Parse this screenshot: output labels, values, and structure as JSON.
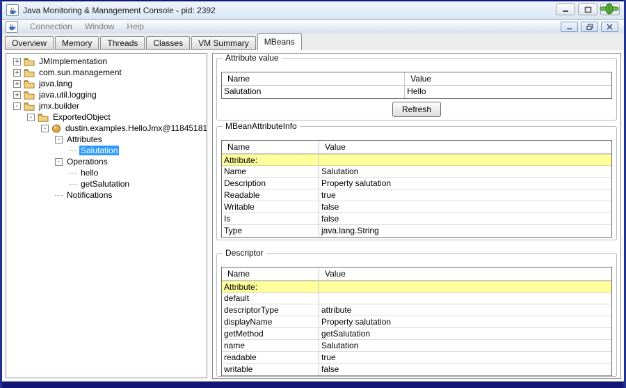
{
  "window": {
    "title": "Java Monitoring & Management Console - pid: 2392"
  },
  "menu": {
    "items": [
      "Connection",
      "Window",
      "Help"
    ]
  },
  "tabs": {
    "items": [
      "Overview",
      "Memory",
      "Threads",
      "Classes",
      "VM Summary",
      "MBeans"
    ],
    "selected": "MBeans"
  },
  "tree": {
    "nodes": [
      {
        "label": "JMImplementation",
        "level": 0,
        "toggle": "+",
        "icon": "folder",
        "selected": false
      },
      {
        "label": "com.sun.management",
        "level": 0,
        "toggle": "+",
        "icon": "folder",
        "selected": false
      },
      {
        "label": "java.lang",
        "level": 0,
        "toggle": "+",
        "icon": "folder",
        "selected": false
      },
      {
        "label": "java.util.logging",
        "level": 0,
        "toggle": "+",
        "icon": "folder",
        "selected": false
      },
      {
        "label": "jmx.builder",
        "level": 0,
        "toggle": "-",
        "icon": "folder",
        "selected": false
      },
      {
        "label": "ExportedObject",
        "level": 1,
        "toggle": "-",
        "icon": "folder",
        "selected": false
      },
      {
        "label": "dustin.examples.HelloJmx@11845181",
        "level": 2,
        "toggle": "-",
        "icon": "mbean",
        "selected": false
      },
      {
        "label": "Attributes",
        "level": 3,
        "toggle": "-",
        "icon": null,
        "selected": false
      },
      {
        "label": "Salutation",
        "level": 4,
        "toggle": null,
        "icon": null,
        "selected": true
      },
      {
        "label": "Operations",
        "level": 3,
        "toggle": "-",
        "icon": null,
        "selected": false
      },
      {
        "label": "hello",
        "level": 4,
        "toggle": null,
        "icon": null,
        "selected": false
      },
      {
        "label": "getSalutation",
        "level": 4,
        "toggle": null,
        "icon": null,
        "selected": false
      },
      {
        "label": "Notifications",
        "level": 3,
        "toggle": null,
        "icon": null,
        "selected": false
      }
    ]
  },
  "panels": {
    "attribute_value": {
      "title": "Attribute value",
      "columns": [
        "Name",
        "Value"
      ],
      "rows": [
        {
          "name": "Salutation",
          "value": "Hello",
          "highlight": false
        }
      ],
      "button": "Refresh"
    },
    "mbean_attribute_info": {
      "title": "MBeanAttributeInfo",
      "columns": [
        "Name",
        "Value"
      ],
      "rows": [
        {
          "name": "Attribute:",
          "value": "",
          "highlight": true
        },
        {
          "name": "Name",
          "value": "Salutation",
          "highlight": false
        },
        {
          "name": "Description",
          "value": "Property salutation",
          "highlight": false
        },
        {
          "name": "Readable",
          "value": "true",
          "highlight": false
        },
        {
          "name": "Writable",
          "value": "false",
          "highlight": false
        },
        {
          "name": "Is",
          "value": "false",
          "highlight": false
        },
        {
          "name": "Type",
          "value": "java.lang.String",
          "highlight": false
        }
      ]
    },
    "descriptor": {
      "title": "Descriptor",
      "columns": [
        "Name",
        "Value"
      ],
      "rows": [
        {
          "name": "Attribute:",
          "value": "",
          "highlight": true
        },
        {
          "name": "default",
          "value": "",
          "highlight": false
        },
        {
          "name": "descriptorType",
          "value": "attribute",
          "highlight": false
        },
        {
          "name": "displayName",
          "value": "Property salutation",
          "highlight": false
        },
        {
          "name": "getMethod",
          "value": "getSalutation",
          "highlight": false
        },
        {
          "name": "name",
          "value": "Salutation",
          "highlight": false
        },
        {
          "name": "readable",
          "value": "true",
          "highlight": false
        },
        {
          "name": "writable",
          "value": "false",
          "highlight": false
        }
      ]
    }
  },
  "colors": {
    "selection": "#2E9AFE",
    "highlight_row": "#FFFF9E",
    "window_border": "#121677",
    "titlebar": "#DCE9F8",
    "connected_green": "#57A839"
  }
}
